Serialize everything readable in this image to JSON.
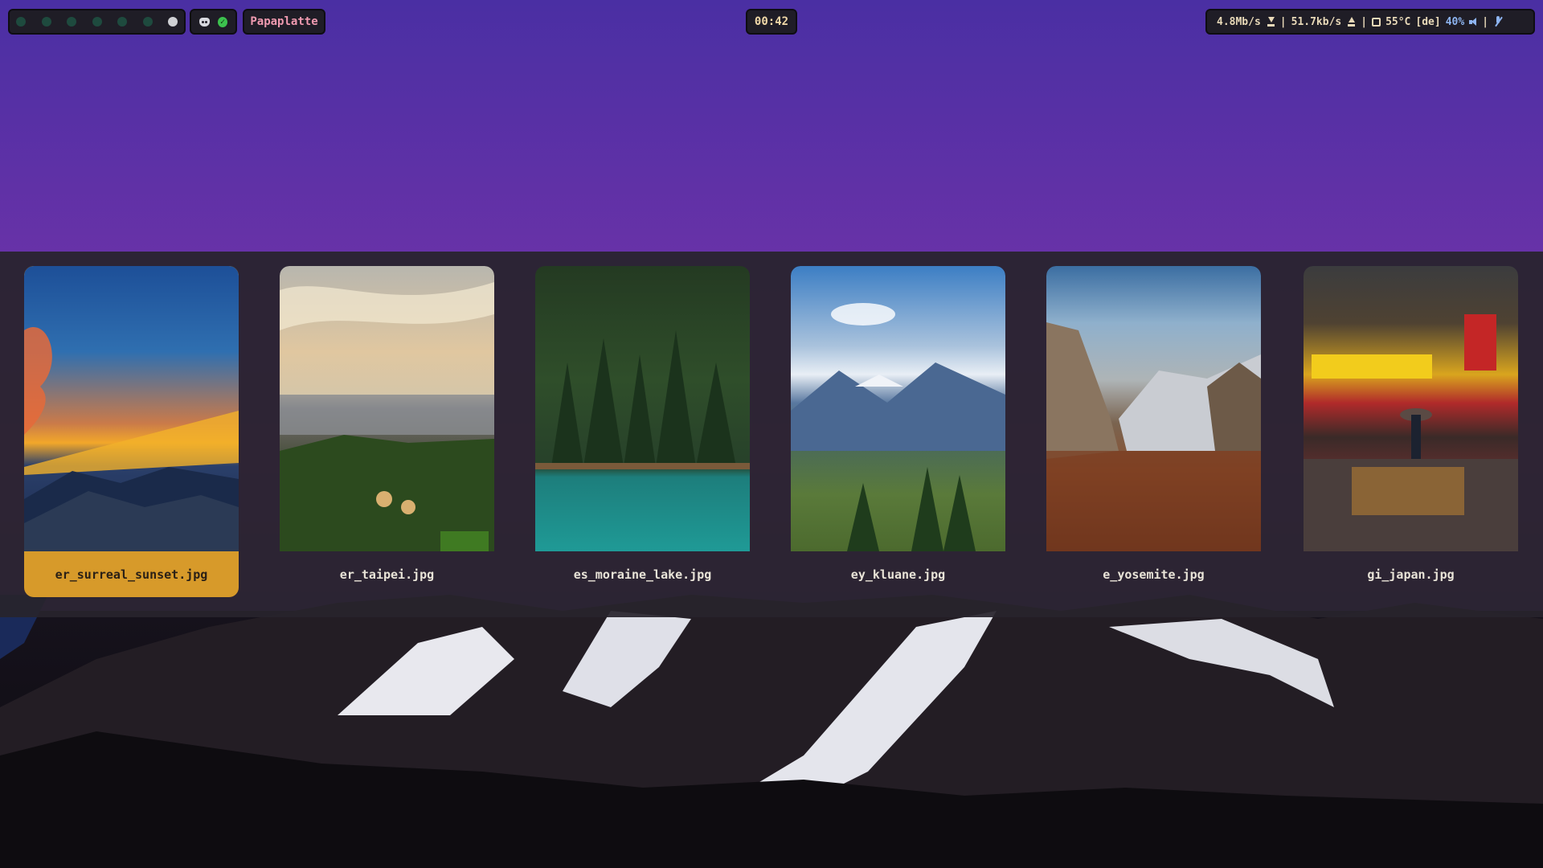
{
  "topbar": {
    "workspaces": [
      {
        "active": false
      },
      {
        "active": false
      },
      {
        "active": false
      },
      {
        "active": false
      },
      {
        "active": false
      },
      {
        "active": false
      },
      {
        "active": true
      }
    ],
    "window_title": "Papaplatte",
    "clock": "00:42",
    "status": {
      "download": "4.8Mb/s",
      "upload": "51.7kb/s",
      "separator": "|",
      "cpu_temp": "55°C",
      "keyboard_layout": "[de]",
      "volume": "40%"
    }
  },
  "picker": {
    "items": [
      {
        "filename": "er_surreal_sunset.jpg",
        "selected": true
      },
      {
        "filename": "er_taipei.jpg",
        "selected": false
      },
      {
        "filename": "es_moraine_lake.jpg",
        "selected": false
      },
      {
        "filename": "ey_kluane.jpg",
        "selected": false
      },
      {
        "filename": "e_yosemite.jpg",
        "selected": false
      },
      {
        "filename": "gi_japan.jpg",
        "selected": false
      }
    ]
  },
  "colors": {
    "selection_accent": "#d79a2a",
    "workspace_inactive": "#1e4a3e",
    "title_pink": "#f09ab0",
    "volume_blue": "#8db4f0"
  },
  "icons": [
    "discord-icon",
    "check-icon",
    "download-icon",
    "upload-icon",
    "cpu-icon",
    "speaker-icon",
    "mic-off-icon"
  ]
}
